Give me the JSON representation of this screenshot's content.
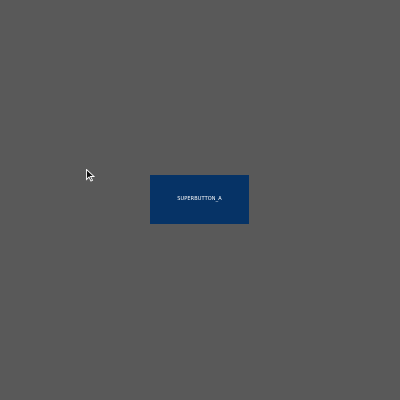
{
  "window": {
    "background_color": "#595959"
  },
  "button": {
    "label": "SUPERBUTTON_A",
    "background_color": "#063366",
    "text_color": "#ffffff"
  },
  "cursor": {
    "icon": "arrow-cursor-icon"
  }
}
